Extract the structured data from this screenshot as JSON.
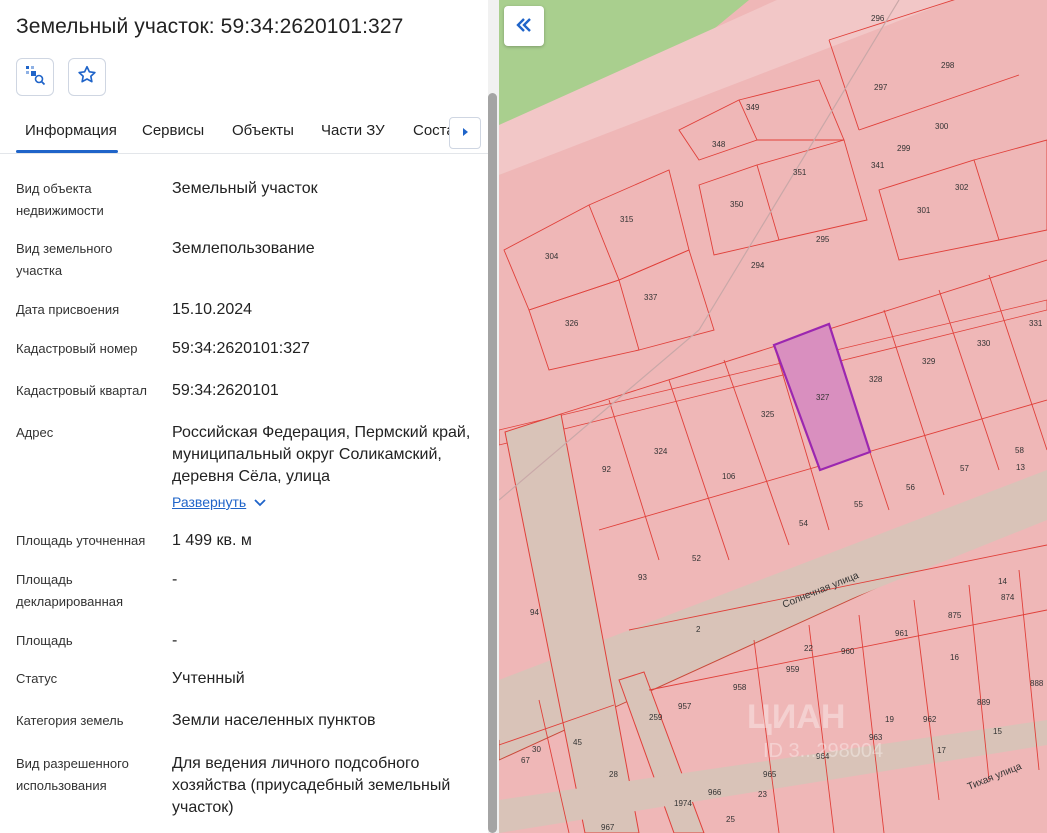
{
  "title": "Земельный участок: 59:34:2620101:327",
  "tabs": [
    "Информация",
    "Сервисы",
    "Объекты",
    "Части ЗУ",
    "Соста"
  ],
  "rows": [
    {
      "label": "Вид объекта недвижимости",
      "value": "Земельный участок"
    },
    {
      "label": "Вид земельного участка",
      "value": "Землепользование"
    },
    {
      "label": "Дата присвоения",
      "value": "15.10.2024"
    },
    {
      "label": "Кадастровый номер",
      "value": "59:34:2620101:327"
    },
    {
      "label": "Кадастровый квартал",
      "value": "59:34:2620101"
    },
    {
      "label": "Адрес",
      "value": "Российская Федерация, Пермский край, муниципальный округ Соликамский, деревня Сёла, улица"
    },
    {
      "label": "Площадь уточненная",
      "value": "1 499 кв. м"
    },
    {
      "label": "Площадь декларированная",
      "value": "-"
    },
    {
      "label": "Площадь",
      "value": "-"
    },
    {
      "label": "Статус",
      "value": "Учтенный"
    },
    {
      "label": "Категория земель",
      "value": "Земли населенных пунктов"
    },
    {
      "label": "Вид разрешенного использования",
      "value": "Для ведения личного подсобного хозяйства (приусадебный земельный участок)"
    }
  ],
  "expand_label": "Развернуть",
  "icons": {
    "map_search": "map-search-icon",
    "favorite": "star-icon",
    "tab_next": "chevron-right-icon",
    "collapse": "double-chevron-left-icon"
  },
  "colors": {
    "accent": "#1f64c9",
    "parcel_fill": "#efb7b7",
    "parcel_stroke": "#e0403a",
    "selected_stroke": "#9b27b0",
    "road": "#d9c3b8"
  },
  "map": {
    "streets": [
      "Солнечная улица",
      "Тихая улица"
    ],
    "selected_plot": "327",
    "plots": [
      "296",
      "298",
      "297",
      "300",
      "349",
      "348",
      "351",
      "299",
      "341",
      "302",
      "301",
      "315",
      "350",
      "295",
      "304",
      "294",
      "337",
      "326",
      "331",
      "330",
      "329",
      "328",
      "327",
      "325",
      "324",
      "92",
      "106",
      "13",
      "58",
      "57",
      "56",
      "55",
      "54",
      "52",
      "93",
      "94",
      "2",
      "14",
      "874",
      "875",
      "961",
      "960",
      "22",
      "16",
      "959",
      "958",
      "888",
      "889",
      "957",
      "19",
      "962",
      "259",
      "963",
      "17",
      "15",
      "964",
      "30",
      "45",
      "67",
      "965",
      "28",
      "23",
      "966",
      "1974",
      "25",
      "967"
    ]
  },
  "watermark": "ЦИАН",
  "watermark_id": "ID 3...298004"
}
